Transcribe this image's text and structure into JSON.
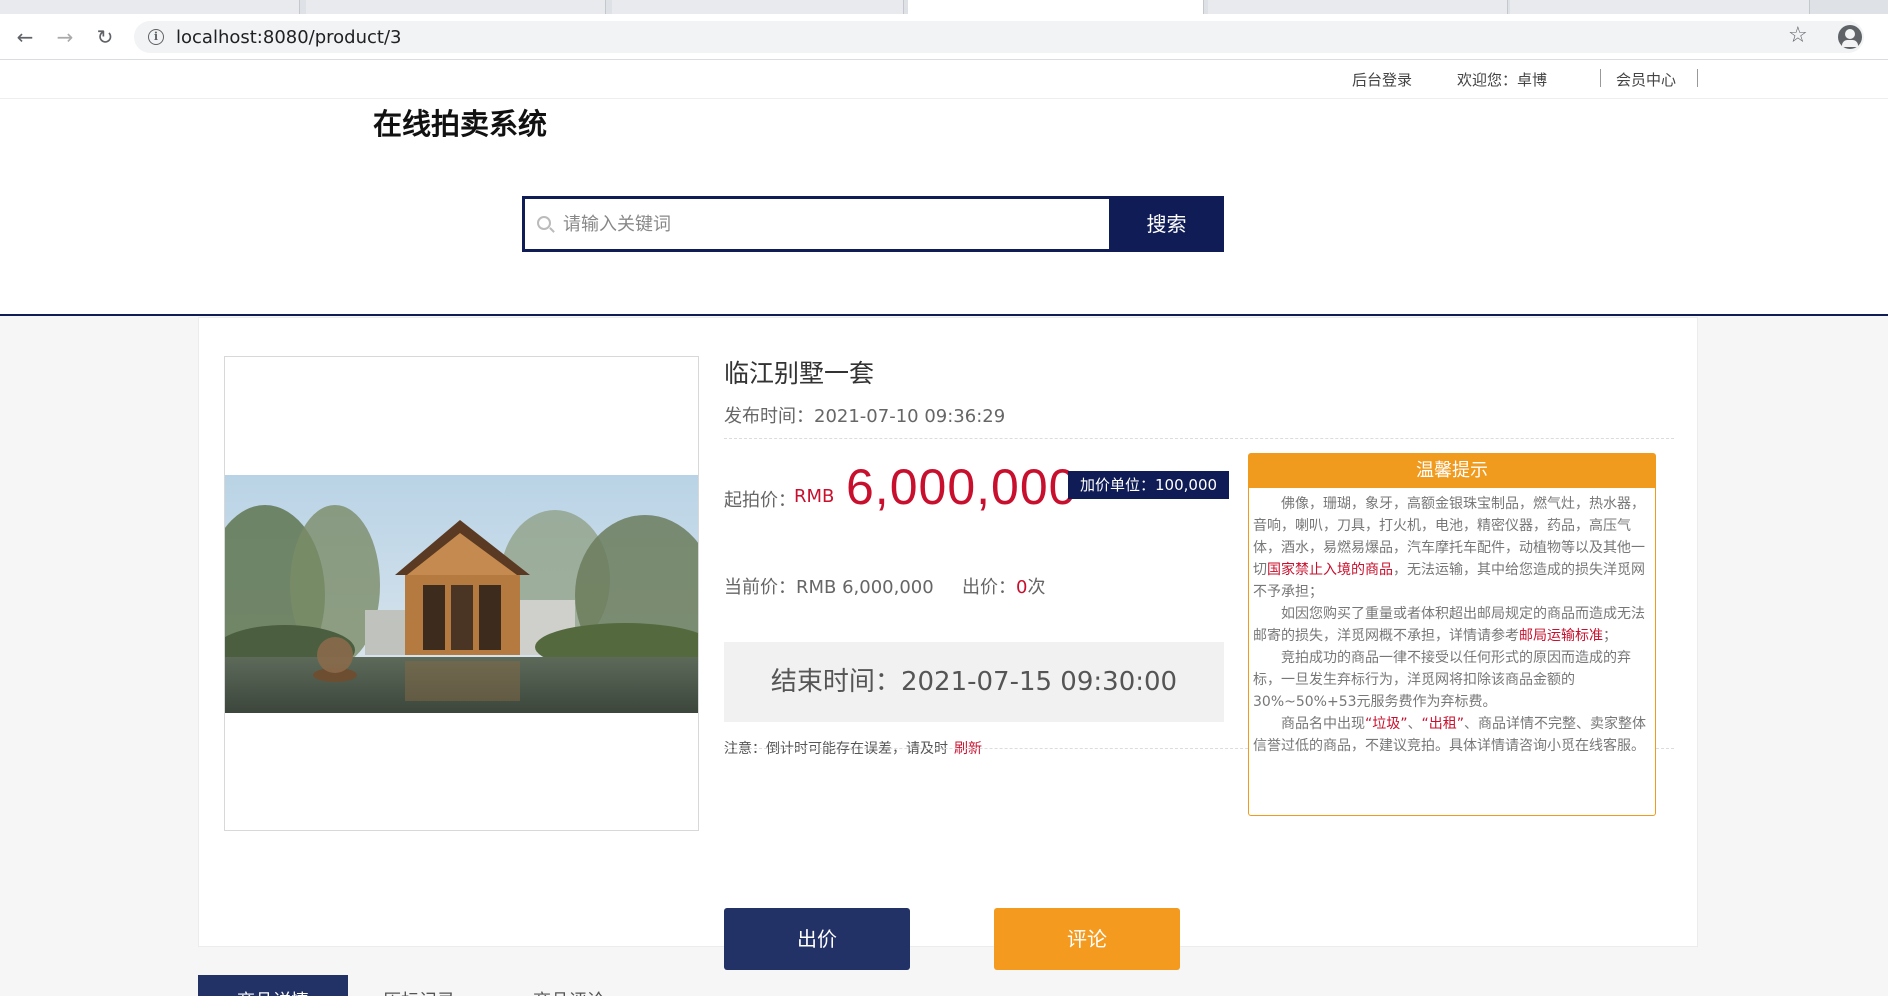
{
  "browser": {
    "url": "localhost:8080/product/3"
  },
  "topbar": {
    "admin_login": "后台登录",
    "welcome": "欢迎您：卓博",
    "member_center": "会员中心"
  },
  "site": {
    "title": "在线拍卖系统"
  },
  "search": {
    "placeholder": "请输入关键词",
    "button_label": "搜索"
  },
  "product": {
    "title": "临江别墅一套",
    "publish_label": "发布时间：",
    "publish_time": "2021-07-10 09:36:29",
    "start_price_label": "起拍价：",
    "start_currency": "RMB",
    "start_price": "6,000,000",
    "increment_label": "加价单位：100,000",
    "current_price_label": "当前价：",
    "current_price": "RMB 6,000,000",
    "bid_count_label": "出价：",
    "bid_count": "0",
    "bid_count_unit": "次",
    "end_time_label": "结束时间：",
    "end_time": "2021-07-15 09:30:00",
    "note": "注意：倒计时可能存在误差，请及时",
    "refresh_label": "刷新"
  },
  "tips": {
    "title": "温馨提示",
    "p1_a": "佛像，珊瑚，象牙，高额金银珠宝制品，燃气灶，热水器，音响，喇叭，刀具，打火机，电池，精密仪器，药品，高压气体，酒水，易燃易爆品，汽车摩托车配件，动植物等以及其他一切",
    "p1_hl": "国家禁止入境的商品",
    "p1_b": "，无法运输，其中给您造成的损失洋觅网不予承担；",
    "p2_a": "如因您购买了重量或者体积超出邮局规定的商品而造成无法邮寄的损失，洋觅网概不承担，详情请参考",
    "p2_hl": "邮局运输标准",
    "p2_b": "；",
    "p3": "竞拍成功的商品一律不接受以任何形式的原因而造成的弃标，一旦发生弃标行为，洋觅网将扣除该商品金额的30%~50%+53元服务费作为弃标费。",
    "p4_a": "商品名中出现",
    "p4_hl1": "“垃圾”",
    "p4_mid": "、",
    "p4_hl2": "“出租”",
    "p4_b": "、商品详情不完整、卖家整体信誉过低的商品，不建议竞拍。具体详情请咨询小觅在线客服。"
  },
  "actions": {
    "bid_label": "出价",
    "comment_label": "评论"
  },
  "bottom_tabs": {
    "tab1": "商品详情",
    "tab2": "历标记录",
    "tab3": "商品评论"
  }
}
